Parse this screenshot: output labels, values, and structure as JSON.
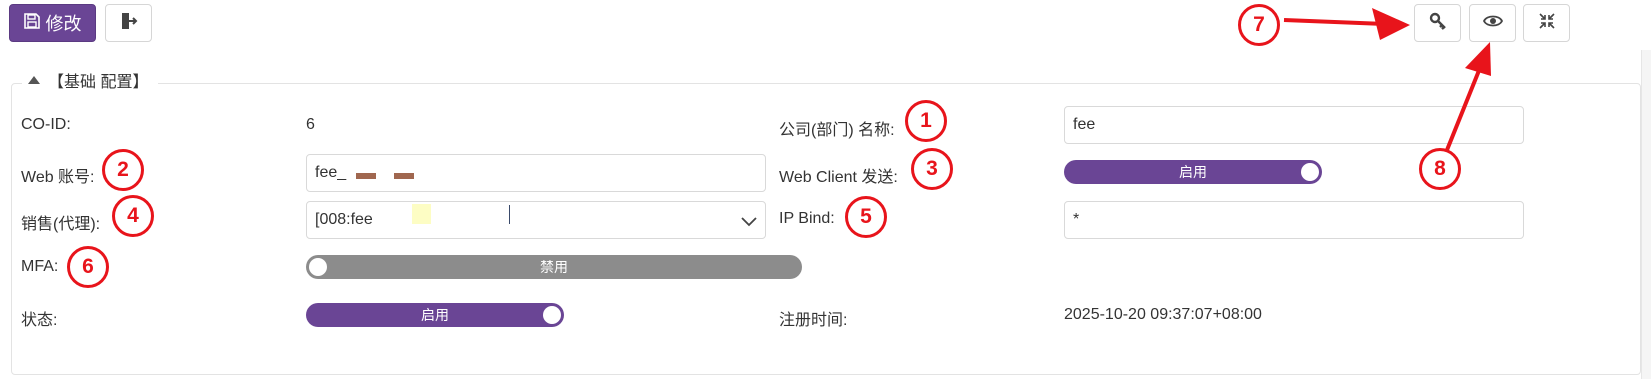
{
  "toolbar": {
    "save_label": "修改",
    "save_icon": "floppy-disk-icon",
    "exit_icon": "exit-door-icon",
    "key_icon": "key-icon",
    "eye_icon": "eye-icon",
    "collapse_icon": "compress-icon"
  },
  "section": {
    "title": "【基础 配置】"
  },
  "fields": {
    "coid_label": "CO-ID:",
    "coid_value": "6",
    "company_label": "公司(部门) 名称:",
    "company_value": "fee",
    "web_account_label": "Web 账号:",
    "web_account_value": "fee_",
    "web_client_label": "Web Client 发送:",
    "web_client_state": "启用",
    "sales_label": "销售(代理):",
    "sales_value": "[008:fee",
    "ip_bind_label": "IP Bind:",
    "ip_bind_value": "*",
    "mfa_label": "MFA:",
    "mfa_state": "禁用",
    "status_label": "状态:",
    "status_state": "启用",
    "reg_time_label": "注册时间:",
    "reg_time_value": "2025-10-20 09:37:07+08:00"
  },
  "annotations": [
    "1",
    "2",
    "3",
    "4",
    "5",
    "6",
    "7",
    "8"
  ],
  "colors": {
    "accent": "#6a4595",
    "annotation": "#e8141b",
    "disabled": "#8c8c8c"
  }
}
